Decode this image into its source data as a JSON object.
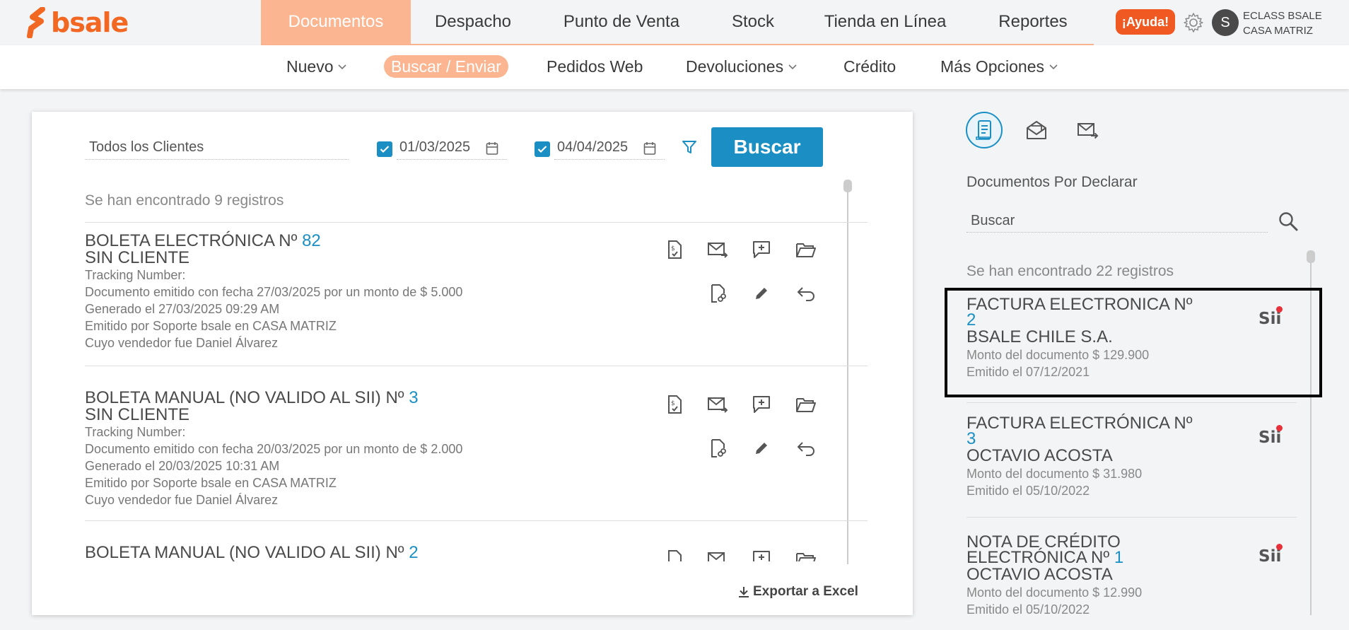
{
  "brand": {
    "logo_text": "bsale",
    "accent": "#f26722",
    "primary": "#1b8fc3"
  },
  "main_nav": {
    "items": [
      {
        "label": "Documentos",
        "active": true
      },
      {
        "label": "Despacho"
      },
      {
        "label": "Punto de Venta"
      },
      {
        "label": "Stock"
      },
      {
        "label": "Tienda en Línea"
      },
      {
        "label": "Reportes"
      }
    ]
  },
  "header": {
    "help_label": "¡Ayuda!",
    "avatar_initial": "S",
    "user_line1": "ECLASS BSALE",
    "user_line2": "CASA MATRIZ"
  },
  "sub_nav": {
    "items": [
      {
        "label": "Nuevo",
        "dropdown": true
      },
      {
        "label": "Buscar / Enviar",
        "active": true
      },
      {
        "label": "Pedidos Web"
      },
      {
        "label": "Devoluciones",
        "dropdown": true
      },
      {
        "label": "Crédito"
      },
      {
        "label": "Más Opciones",
        "dropdown": true
      }
    ]
  },
  "filters": {
    "client_value": "Todos los Clientes",
    "date_from": "01/03/2025",
    "date_to": "04/04/2025",
    "date_from_checked": true,
    "date_to_checked": true,
    "search_label": "Buscar"
  },
  "results": {
    "count_text": "Se han encontrado 9 registros",
    "documents": [
      {
        "title": "BOLETA ELECTRÓNICA Nº",
        "number": "82",
        "client": "SIN CLIENTE",
        "tracking": "Tracking Number:",
        "emitted": "Documento emitido con fecha 27/03/2025 por un monto de $ 5.000",
        "generated": "Generado el 27/03/2025 09:29 AM",
        "issued_by": "Emitido por Soporte bsale en CASA MATRIZ",
        "seller": "Cuyo vendedor fue Daniel Álvarez"
      },
      {
        "title": "BOLETA MANUAL (NO VALIDO AL SII) Nº",
        "number": "3",
        "client": "SIN CLIENTE",
        "tracking": "Tracking Number:",
        "emitted": "Documento emitido con fecha 20/03/2025 por un monto de $ 2.000",
        "generated": "Generado el 20/03/2025 10:31 AM",
        "issued_by": "Emitido por Soporte bsale en CASA MATRIZ",
        "seller": "Cuyo vendedor fue Daniel Álvarez"
      },
      {
        "title": "BOLETA MANUAL (NO VALIDO AL SII) Nº",
        "number": "2"
      }
    ],
    "export_label": "Exportar a Excel"
  },
  "right_panel": {
    "title": "Documentos Por Declarar",
    "search_placeholder": "Buscar",
    "count_text": "Se han encontrado 22 registros",
    "sii_label": "Sii",
    "documents": [
      {
        "title": "FACTURA ELECTRÓNICA Nº",
        "number": "2",
        "client": "BSALE CHILE S.A.",
        "amount": "Monto del documento $ 129.900",
        "date": "Emitido el 07/12/2021"
      },
      {
        "title": "FACTURA ELECTRÓNICA Nº",
        "number": "3",
        "client": "OCTAVIO ACOSTA",
        "amount": "Monto del documento $ 31.980",
        "date": "Emitido el 05/10/2022"
      },
      {
        "title": "NOTA DE CRÉDITO",
        "title2": "ELECTRÓNICA Nº",
        "number": "1",
        "client": "OCTAVIO ACOSTA",
        "amount": "Monto del documento $ 12.990",
        "date": "Emitido el 05/10/2022"
      }
    ]
  }
}
